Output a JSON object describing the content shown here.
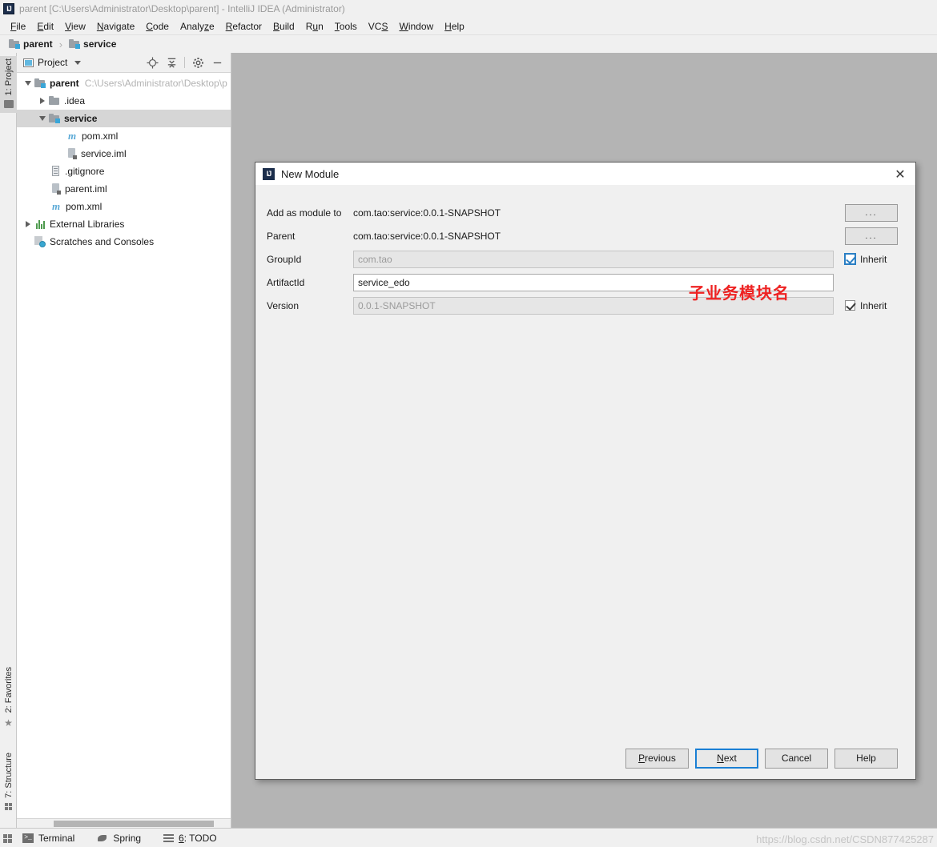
{
  "window": {
    "app_icon": "intellij-idea-logo",
    "title": "parent [C:\\Users\\Administrator\\Desktop\\parent] - IntelliJ IDEA (Administrator)"
  },
  "menubar": {
    "items": [
      {
        "label": "File"
      },
      {
        "label": "Edit"
      },
      {
        "label": "View"
      },
      {
        "label": "Navigate"
      },
      {
        "label": "Code"
      },
      {
        "label": "Analyze"
      },
      {
        "label": "Refactor"
      },
      {
        "label": "Build"
      },
      {
        "label": "Run"
      },
      {
        "label": "Tools"
      },
      {
        "label": "VCS"
      },
      {
        "label": "Window"
      },
      {
        "label": "Help"
      }
    ]
  },
  "breadcrumb": {
    "items": [
      {
        "label": "parent"
      },
      {
        "label": "service"
      }
    ],
    "separator": "›"
  },
  "left_strip": {
    "tabs": [
      {
        "label": "1: Project",
        "icon": "folder-icon"
      },
      {
        "label": "2: Favorites",
        "icon": "star-icon"
      },
      {
        "label": "7: Structure",
        "icon": "structure-icon"
      }
    ]
  },
  "project_panel": {
    "title": "Project",
    "toolbar": [
      {
        "name": "locate-icon",
        "tooltip": "Select Opened File"
      },
      {
        "name": "collapse-all-icon",
        "tooltip": "Collapse All"
      },
      {
        "name": "gear-icon",
        "tooltip": "Settings"
      },
      {
        "name": "minimize-icon",
        "tooltip": "Hide"
      }
    ],
    "tree": [
      {
        "label": "parent",
        "path": "C:\\Users\\Administrator\\Desktop\\pa",
        "icon": "module-folder-icon",
        "indent": 0,
        "expanded": true,
        "bold": true,
        "selected": false
      },
      {
        "label": ".idea",
        "path": "",
        "icon": "folder-icon",
        "indent": 1,
        "expanded": false,
        "bold": false,
        "selected": false
      },
      {
        "label": "service",
        "path": "",
        "icon": "module-folder-icon",
        "indent": 1,
        "expanded": true,
        "bold": true,
        "selected": true
      },
      {
        "label": "pom.xml",
        "path": "",
        "icon": "maven-icon",
        "indent": 2,
        "expanded": null,
        "bold": false,
        "selected": false
      },
      {
        "label": "service.iml",
        "path": "",
        "icon": "iml-icon",
        "indent": 2,
        "expanded": null,
        "bold": false,
        "selected": false
      },
      {
        "label": ".gitignore",
        "path": "",
        "icon": "gitignore-icon",
        "indent": 1,
        "expanded": null,
        "bold": false,
        "selected": false
      },
      {
        "label": "parent.iml",
        "path": "",
        "icon": "iml-icon",
        "indent": 1,
        "expanded": null,
        "bold": false,
        "selected": false
      },
      {
        "label": "pom.xml",
        "path": "",
        "icon": "maven-icon",
        "indent": 1,
        "expanded": null,
        "bold": false,
        "selected": false
      },
      {
        "label": "External Libraries",
        "path": "",
        "icon": "libraries-icon",
        "indent": 0,
        "expanded": false,
        "bold": false,
        "selected": false
      },
      {
        "label": "Scratches and Consoles",
        "path": "",
        "icon": "scratches-icon",
        "indent": 0,
        "expanded": null,
        "bold": false,
        "selected": false
      }
    ]
  },
  "dialog": {
    "icon": "intellij-idea-logo",
    "title": "New Module",
    "close_label": "✕",
    "fields": [
      {
        "label": "Add as module to",
        "type": "static",
        "value": "com.tao:service:0.0.1-SNAPSHOT",
        "button": "...",
        "has_button": true,
        "has_inherit": false
      },
      {
        "label": "Parent",
        "type": "static",
        "value": "com.tao:service:0.0.1-SNAPSHOT",
        "button": "...",
        "has_button": true,
        "has_inherit": false
      },
      {
        "label": "GroupId",
        "type": "input",
        "value": "com.tao",
        "disabled": true,
        "has_button": false,
        "has_inherit": true,
        "inherit_label": "Inherit",
        "inherit_checked": true,
        "inherit_focused": true
      },
      {
        "label": "ArtifactId",
        "type": "input",
        "value": "service_edo",
        "disabled": false,
        "has_button": false,
        "has_inherit": false
      },
      {
        "label": "Version",
        "type": "input",
        "value": "0.0.1-SNAPSHOT",
        "disabled": true,
        "has_button": false,
        "has_inherit": true,
        "inherit_label": "Inherit",
        "inherit_checked": true,
        "inherit_focused": false
      }
    ],
    "annotation": {
      "text": "子业务模块名",
      "color": "#ee2222"
    },
    "buttons": [
      {
        "label": "Previous",
        "focused": false
      },
      {
        "label": "Next",
        "focused": true
      },
      {
        "label": "Cancel",
        "focused": false
      },
      {
        "label": "Help",
        "focused": false
      }
    ]
  },
  "statusbar": {
    "items": [
      {
        "label": "Terminal",
        "icon": "terminal-icon"
      },
      {
        "label": "Spring",
        "icon": "spring-icon"
      },
      {
        "label": "6: TODO",
        "icon": "todo-icon"
      }
    ]
  },
  "watermark": {
    "text": "https://blog.csdn.net/CSDN877425287"
  },
  "colors": {
    "accent": "#1a7fd4",
    "editor_background": "#b4b4b4",
    "panel_background": "#f0f0f0",
    "selection": "#d6d6d6",
    "annotation_red": "#ee2222",
    "folder_blue": "#3aa6d8"
  }
}
